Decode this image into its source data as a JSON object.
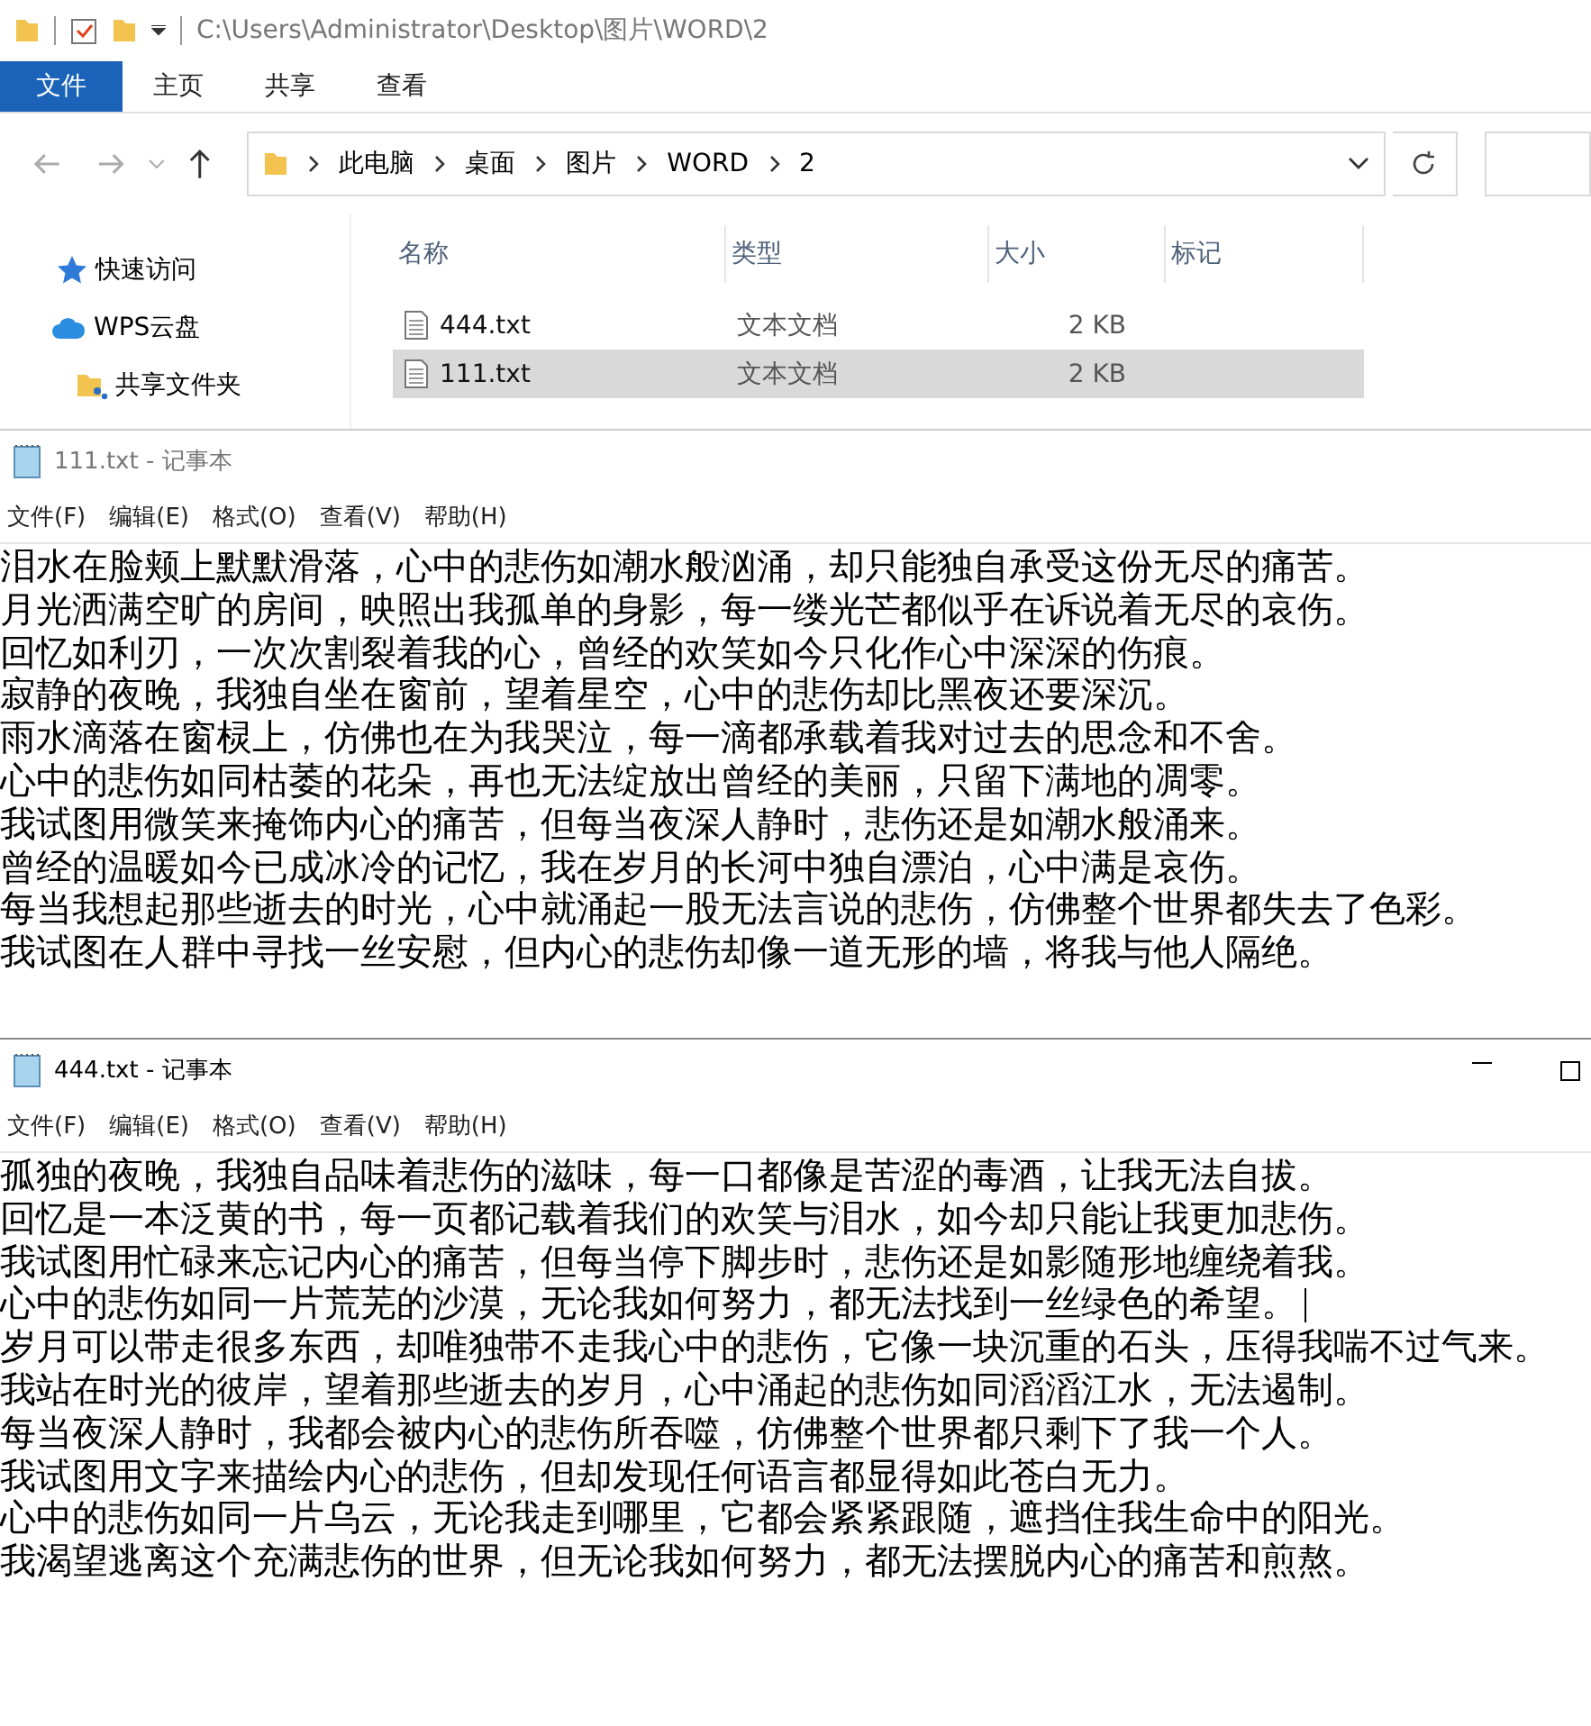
{
  "explorer": {
    "title_path": "C:\\Users\\Administrator\\Desktop\\图片\\WORD\\2",
    "ribbon_tabs": [
      {
        "label": "文件",
        "selected": true
      },
      {
        "label": "主页",
        "selected": false
      },
      {
        "label": "共享",
        "selected": false
      },
      {
        "label": "查看",
        "selected": false
      }
    ],
    "breadcrumb": [
      "此电脑",
      "桌面",
      "图片",
      "WORD",
      "2"
    ],
    "nav_items": [
      {
        "label": "快速访问",
        "kind": "star"
      },
      {
        "label": "WPS云盘",
        "kind": "cloud"
      },
      {
        "label": "共享文件夹",
        "kind": "folder"
      }
    ],
    "columns": [
      "名称",
      "类型",
      "大小",
      "标记"
    ],
    "files": [
      {
        "name": "444.txt",
        "type": "文本文档",
        "size": "2 KB",
        "selected": false
      },
      {
        "name": "111.txt",
        "type": "文本文档",
        "size": "2 KB",
        "selected": true
      }
    ]
  },
  "notepads": [
    {
      "title": "111.txt - 记事本",
      "controls": false,
      "menu": [
        "文件(F)",
        "编辑(E)",
        "格式(O)",
        "查看(V)",
        "帮助(H)"
      ],
      "lines": [
        {
          "text": "泪水在脸颊上默默滑落，心中的悲伤如潮水般汹涌，却只能独自承受这份无尽的痛苦。",
          "cursor": false
        },
        {
          "text": "月光洒满空旷的房间，映照出我孤单的身影，每一缕光芒都似乎在诉说着无尽的哀伤。",
          "cursor": false
        },
        {
          "text": "回忆如利刃，一次次割裂着我的心，曾经的欢笑如今只化作心中深深的伤痕。",
          "cursor": false
        },
        {
          "text": "寂静的夜晚，我独自坐在窗前，望着星空，心中的悲伤却比黑夜还要深沉。",
          "cursor": false
        },
        {
          "text": "雨水滴落在窗棂上，仿佛也在为我哭泣，每一滴都承载着我对过去的思念和不舍。",
          "cursor": false
        },
        {
          "text": "心中的悲伤如同枯萎的花朵，再也无法绽放出曾经的美丽，只留下满地的凋零。",
          "cursor": false
        },
        {
          "text": "我试图用微笑来掩饰内心的痛苦，但每当夜深人静时，悲伤还是如潮水般涌来。",
          "cursor": false
        },
        {
          "text": "曾经的温暖如今已成冰冷的记忆，我在岁月的长河中独自漂泊，心中满是哀伤。",
          "cursor": false
        },
        {
          "text": "每当我想起那些逝去的时光，心中就涌起一股无法言说的悲伤，仿佛整个世界都失去了色彩。",
          "cursor": false
        },
        {
          "text": "我试图在人群中寻找一丝安慰，但内心的悲伤却像一道无形的墙，将我与他人隔绝。",
          "cursor": false
        }
      ]
    },
    {
      "title": "444.txt - 记事本",
      "controls": true,
      "menu": [
        "文件(F)",
        "编辑(E)",
        "格式(O)",
        "查看(V)",
        "帮助(H)"
      ],
      "lines": [
        {
          "text": "孤独的夜晚，我独自品味着悲伤的滋味，每一口都像是苦涩的毒酒，让我无法自拔。",
          "cursor": false
        },
        {
          "text": "回忆是一本泛黄的书，每一页都记载着我们的欢笑与泪水，如今却只能让我更加悲伤。",
          "cursor": false
        },
        {
          "text": "我试图用忙碌来忘记内心的痛苦，但每当停下脚步时，悲伤还是如影随形地缠绕着我。",
          "cursor": false
        },
        {
          "text": "心中的悲伤如同一片荒芜的沙漠，无论我如何努力，都无法找到一丝绿色的希望。",
          "cursor": true
        },
        {
          "text": "岁月可以带走很多东西，却唯独带不走我心中的悲伤，它像一块沉重的石头，压得我喘不过气来。",
          "cursor": false
        },
        {
          "text": "我站在时光的彼岸，望着那些逝去的岁月，心中涌起的悲伤如同滔滔江水，无法遏制。",
          "cursor": false
        },
        {
          "text": "每当夜深人静时，我都会被内心的悲伤所吞噬，仿佛整个世界都只剩下了我一个人。",
          "cursor": false
        },
        {
          "text": "我试图用文字来描绘内心的悲伤，但却发现任何语言都显得如此苍白无力。",
          "cursor": false
        },
        {
          "text": "心中的悲伤如同一片乌云，无论我走到哪里，它都会紧紧跟随，遮挡住我生命中的阳光。",
          "cursor": false
        },
        {
          "text": "我渴望逃离这个充满悲伤的世界，但无论我如何努力，都无法摆脱内心的痛苦和煎熬。",
          "cursor": false
        }
      ]
    }
  ]
}
